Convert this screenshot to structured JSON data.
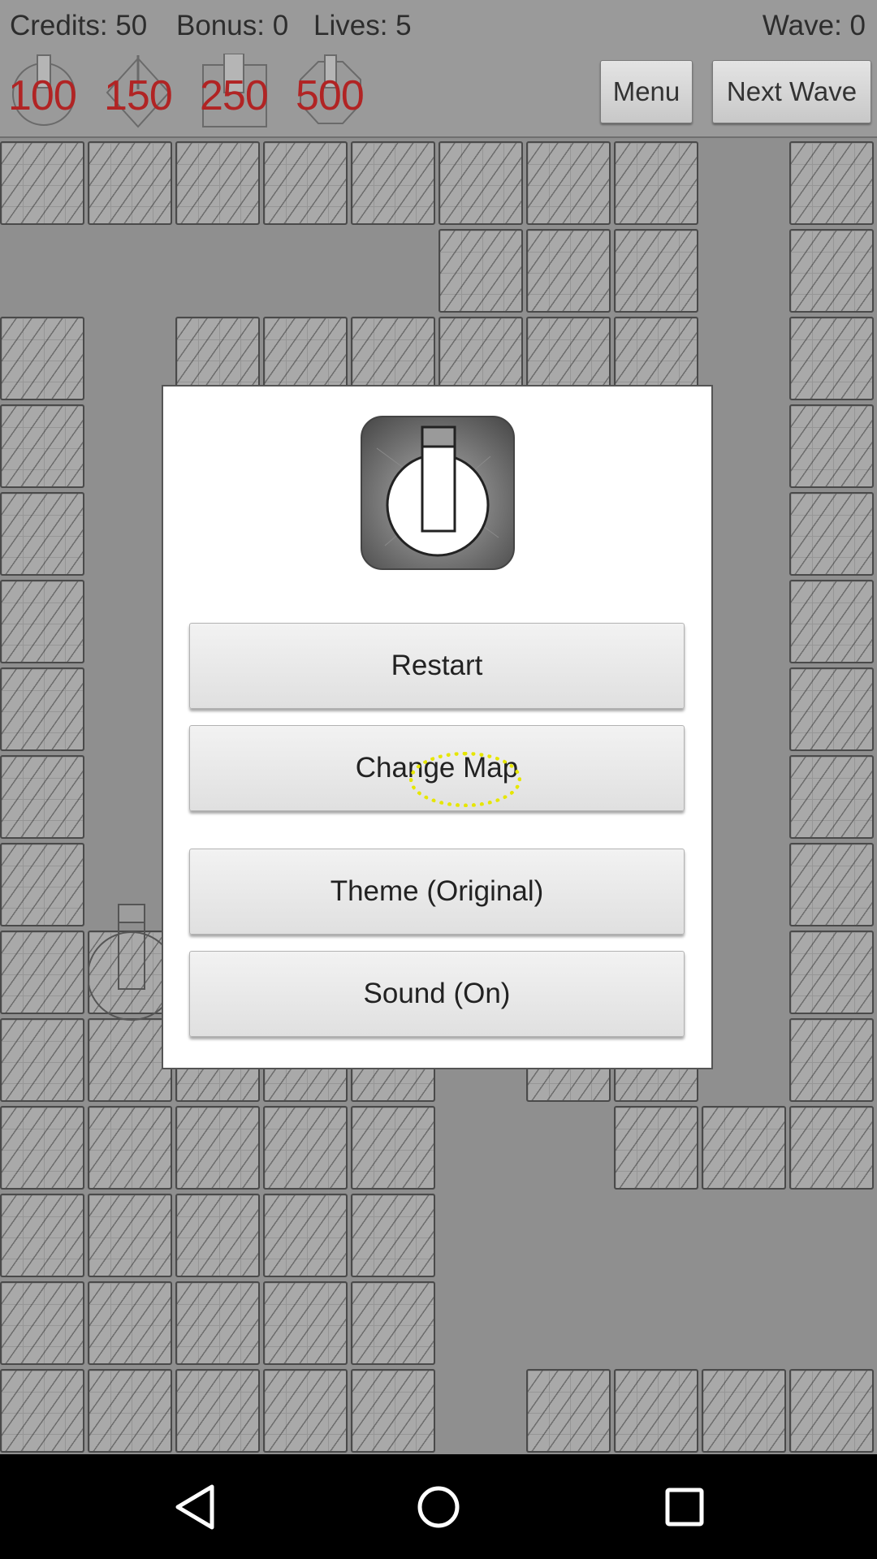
{
  "hud": {
    "credits": "Credits: 50",
    "bonus": "Bonus: 0",
    "lives": "Lives: 5",
    "wave": "Wave: 0",
    "menu_label": "Menu",
    "next_wave_label": "Next Wave",
    "towers": [
      {
        "icon": "round-tower-icon",
        "cost": "100"
      },
      {
        "icon": "diamond-tower-icon",
        "cost": "150"
      },
      {
        "icon": "square-tower-icon",
        "cost": "250"
      },
      {
        "icon": "octagon-tower-icon",
        "cost": "500"
      }
    ]
  },
  "dialog": {
    "icon": "cannon-tower-icon",
    "buttons": [
      {
        "label": "Restart"
      },
      {
        "label": "Change Map"
      },
      {
        "label": "Theme (Original)"
      },
      {
        "label": "Sound (On)"
      }
    ]
  },
  "navbar": {
    "icons": [
      "back-icon",
      "home-icon",
      "recents-icon"
    ]
  },
  "colors": {
    "cost_text": "#b12424",
    "tap_indicator": "#e6e600",
    "background": "#8f8f8f"
  }
}
